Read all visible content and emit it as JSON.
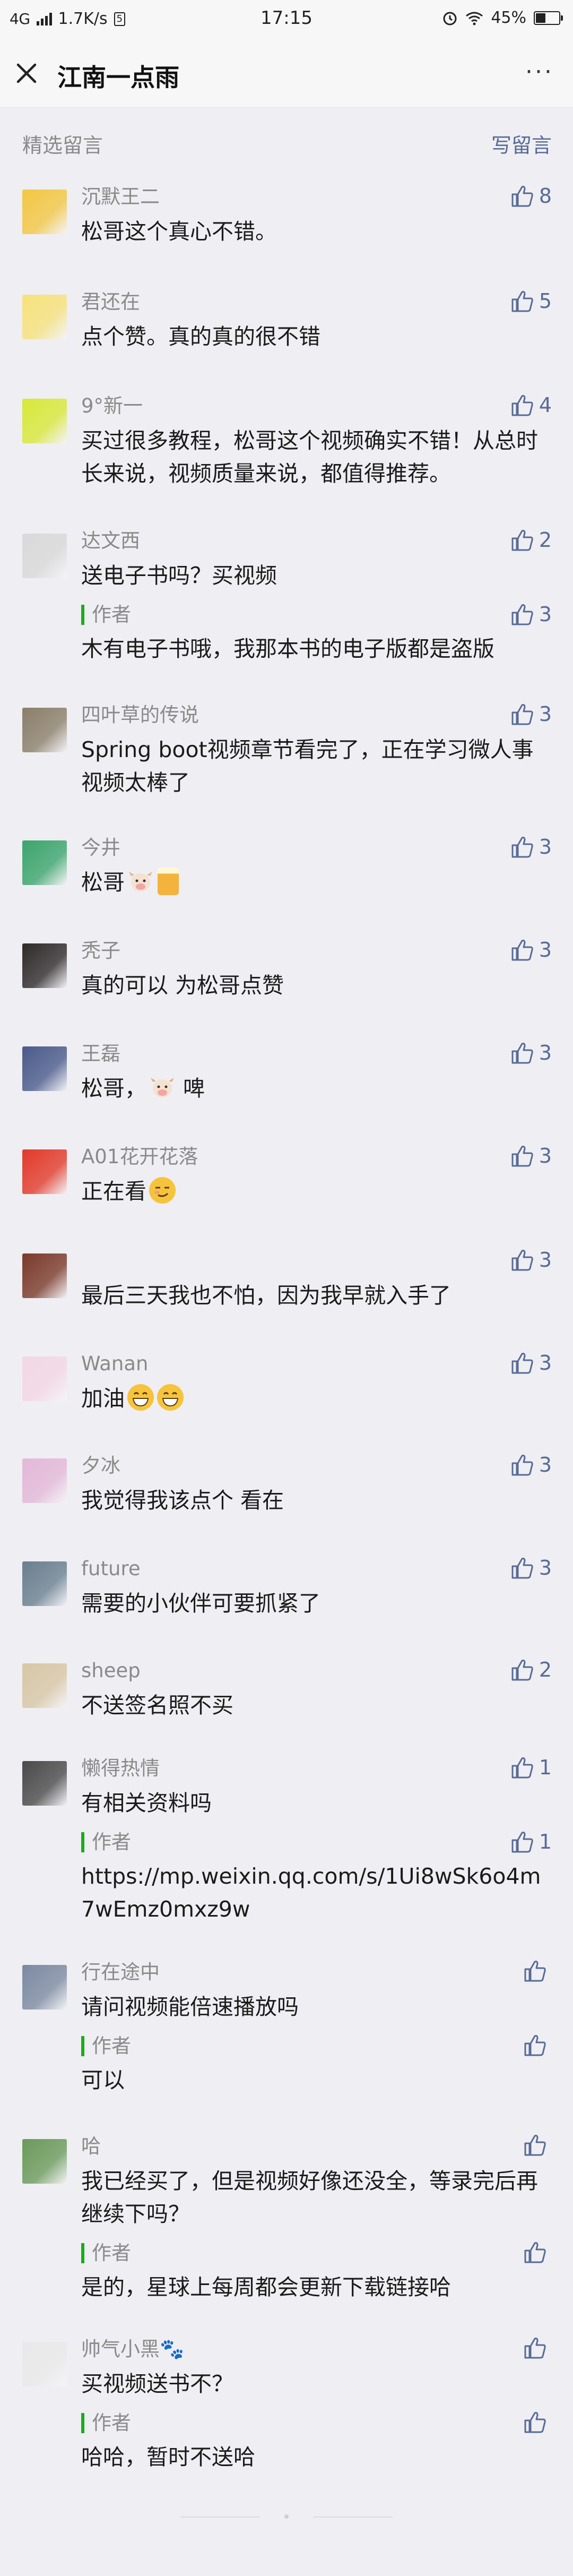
{
  "status_bar": {
    "network": "4G",
    "speed": "1.7K/s",
    "sim_badge": "5",
    "time": "17:15",
    "battery": "45%",
    "battery_level": 0.45
  },
  "navbar": {
    "title": "江南一点雨",
    "more": "···"
  },
  "section": {
    "title": "精选留言",
    "write": "写留言"
  },
  "comments": [
    {
      "name": "沉默王二",
      "text": "松哥这个真心不错。",
      "likes": "8",
      "avatar_color": "#f2c744"
    },
    {
      "name": "君还在",
      "text": "点个赞。真的真的很不错",
      "likes": "5",
      "avatar_color": "#f6e27c"
    },
    {
      "name": "9°新一",
      "text": "买过很多教程，松哥这个视频确实不错！从总时长来说，视频质量来说，都值得推荐。",
      "likes": "4",
      "avatar_color": "#d8e83a"
    },
    {
      "name": "达文西",
      "text": "送电子书吗？买视频",
      "likes": "2",
      "avatar_color": "#d9d9d9",
      "reply": {
        "author": "作者",
        "text": "木有电子书哦，我那本书的电子版都是盗版",
        "likes": "3"
      }
    },
    {
      "name": "四叶草的传说",
      "text": "Spring boot视频章节看完了，正在学习微人事 视频太棒了",
      "likes": "3",
      "avatar_color": "#8b7f6a"
    },
    {
      "name": "今井",
      "text": "松哥",
      "likes": "3",
      "avatar_color": "#3ba56c",
      "emoji": [
        "cow",
        "beer"
      ]
    },
    {
      "name": "秃子",
      "text": "真的可以 为松哥点赞",
      "likes": "3",
      "avatar_color": "#2f2a2a"
    },
    {
      "name": "王磊",
      "text": "松哥，",
      "text_after": "啤",
      "likes": "3",
      "avatar_color": "#4a5a8a",
      "emoji": [
        "cow"
      ]
    },
    {
      "name": "A01花开花落",
      "text": "正在看",
      "likes": "3",
      "avatar_color": "#e23a2a",
      "emoji": [
        "smug"
      ]
    },
    {
      "name": "",
      "text": "最后三天我也不怕，因为我早就入手了",
      "likes": "3",
      "avatar_color": "#7a3a2a"
    },
    {
      "name": "Wanan",
      "text": "加油",
      "likes": "3",
      "avatar_color": "#f3d7e4",
      "emoji": [
        "grin",
        "grin"
      ]
    },
    {
      "name": "夕冰",
      "text": "我觉得我该点个 看在",
      "likes": "3",
      "avatar_color": "#e3b8d8"
    },
    {
      "name": "future",
      "text": "需要的小伙伴可要抓紧了",
      "likes": "3",
      "avatar_color": "#6a7f8f"
    },
    {
      "name": "sheep",
      "text": "不送签名照不买",
      "likes": "2",
      "avatar_color": "#d8c7a6"
    },
    {
      "name": "懒得热情",
      "text": "有相关资料吗",
      "likes": "1",
      "avatar_color": "#4a4a4a",
      "reply": {
        "author": "作者",
        "text": "https://mp.weixin.qq.com/s/1Ui8wSk6o4m7wEmz0mxz9w",
        "likes": "1"
      }
    },
    {
      "name": "行在途中",
      "text": "请问视频能倍速播放吗",
      "likes": "",
      "avatar_color": "#7c8aa0",
      "reply": {
        "author": "作者",
        "text": "可以",
        "likes": ""
      }
    },
    {
      "name": "哈",
      "text": "我已经买了，但是视频好像还没全，等录完后再继续下吗？",
      "likes": "",
      "avatar_color": "#6a9a5a",
      "reply": {
        "author": "作者",
        "text": "是的，星球上每周都会更新下载链接哈",
        "likes": ""
      }
    },
    {
      "name": "帅气小黑🐾",
      "text": "买视频送书不？",
      "likes": "",
      "avatar_color": "#e9e9e9",
      "reply": {
        "author": "作者",
        "text": "哈哈，暂时不送哈",
        "likes": ""
      }
    }
  ],
  "icons": {
    "close": "close-icon",
    "more": "more-icon",
    "like": "thumbs-up-icon"
  },
  "colors": {
    "link": "#576b95",
    "author_bar": "#1aad19",
    "background": "#efeef3"
  }
}
